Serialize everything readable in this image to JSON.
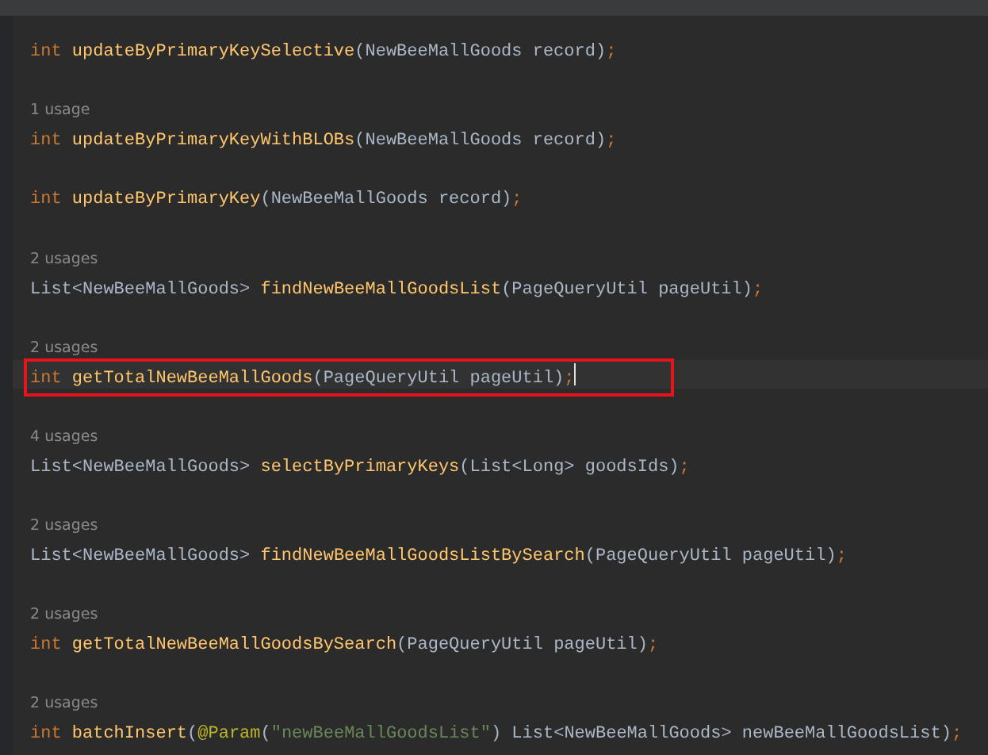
{
  "entries": [
    {
      "current": false,
      "tokens": [
        {
          "kind": "keyword",
          "text": "int "
        },
        {
          "kind": "method",
          "text": "updateByPrimaryKeySelective"
        },
        {
          "kind": "plain",
          "text": "(NewBeeMallGoods record)"
        },
        {
          "kind": "semicolon",
          "text": ";"
        }
      ]
    },
    {
      "usage": "1 usage",
      "current": false,
      "tokens": [
        {
          "kind": "keyword",
          "text": "int "
        },
        {
          "kind": "method",
          "text": "updateByPrimaryKeyWithBLOBs"
        },
        {
          "kind": "plain",
          "text": "(NewBeeMallGoods record)"
        },
        {
          "kind": "semicolon",
          "text": ";"
        }
      ]
    },
    {
      "current": false,
      "tokens": [
        {
          "kind": "keyword",
          "text": "int "
        },
        {
          "kind": "method",
          "text": "updateByPrimaryKey"
        },
        {
          "kind": "plain",
          "text": "(NewBeeMallGoods record)"
        },
        {
          "kind": "semicolon",
          "text": ";"
        }
      ]
    },
    {
      "usage": "2 usages",
      "current": false,
      "tokens": [
        {
          "kind": "plain",
          "text": "List<NewBeeMallGoods> "
        },
        {
          "kind": "method",
          "text": "findNewBeeMallGoodsList"
        },
        {
          "kind": "plain",
          "text": "(PageQueryUtil pageUtil)"
        },
        {
          "kind": "semicolon",
          "text": ";"
        }
      ]
    },
    {
      "usage": "2 usages",
      "current": true,
      "tokens": [
        {
          "kind": "keyword",
          "text": "int "
        },
        {
          "kind": "method",
          "text": "getTotalNewBeeMallGoods"
        },
        {
          "kind": "plain",
          "text": "(PageQueryUtil pageUtil)"
        },
        {
          "kind": "semicolon",
          "text": ";"
        }
      ]
    },
    {
      "usage": "4 usages",
      "current": false,
      "tokens": [
        {
          "kind": "plain",
          "text": "List<NewBeeMallGoods> "
        },
        {
          "kind": "method",
          "text": "selectByPrimaryKeys"
        },
        {
          "kind": "plain",
          "text": "(List<Long> goodsIds)"
        },
        {
          "kind": "semicolon",
          "text": ";"
        }
      ]
    },
    {
      "usage": "2 usages",
      "current": false,
      "tokens": [
        {
          "kind": "plain",
          "text": "List<NewBeeMallGoods> "
        },
        {
          "kind": "method",
          "text": "findNewBeeMallGoodsListBySearch"
        },
        {
          "kind": "plain",
          "text": "(PageQueryUtil pageUtil)"
        },
        {
          "kind": "semicolon",
          "text": ";"
        }
      ]
    },
    {
      "usage": "2 usages",
      "current": false,
      "tokens": [
        {
          "kind": "keyword",
          "text": "int "
        },
        {
          "kind": "method",
          "text": "getTotalNewBeeMallGoodsBySearch"
        },
        {
          "kind": "plain",
          "text": "(PageQueryUtil pageUtil)"
        },
        {
          "kind": "semicolon",
          "text": ";"
        }
      ]
    },
    {
      "usage": "2 usages",
      "current": false,
      "tokens": [
        {
          "kind": "keyword",
          "text": "int "
        },
        {
          "kind": "method",
          "text": "batchInsert"
        },
        {
          "kind": "plain",
          "text": "("
        },
        {
          "kind": "annotation",
          "text": "@Param"
        },
        {
          "kind": "plain",
          "text": "("
        },
        {
          "kind": "string",
          "text": "\"newBeeMallGoodsList\""
        },
        {
          "kind": "plain",
          "text": ") List<NewBeeMallGoods> newBeeMallGoodsList)"
        },
        {
          "kind": "semicolon",
          "text": ";"
        }
      ]
    }
  ]
}
